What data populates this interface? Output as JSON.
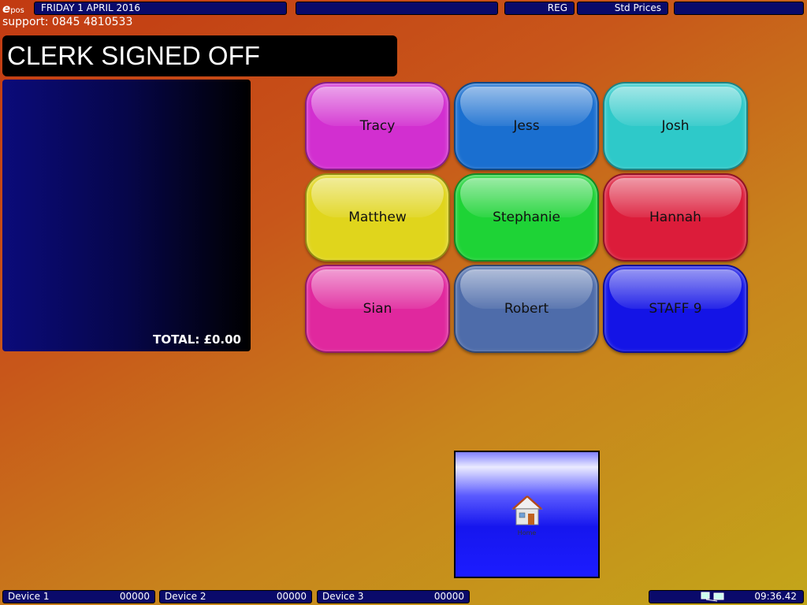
{
  "topbar": {
    "logo_main": "e",
    "logo_sub": "pos",
    "date": "FRIDAY 1 APRIL 2016",
    "mode": "REG",
    "price_level": "Std Prices"
  },
  "support": "support: 0845 4810533",
  "status": "CLERK SIGNED OFF",
  "receipt": {
    "total": "TOTAL: £0.00"
  },
  "clerks": [
    {
      "label": "Tracy",
      "color": "#d22fd0"
    },
    {
      "label": "Jess",
      "color": "#1a6fd0"
    },
    {
      "label": "Josh",
      "color": "#2ec9c9"
    },
    {
      "label": "Matthew",
      "color": "#e0d51c"
    },
    {
      "label": "Stephanie",
      "color": "#1ed336"
    },
    {
      "label": "Hannah",
      "color": "#dc1c3a"
    },
    {
      "label": "Sian",
      "color": "#e0289e"
    },
    {
      "label": "Robert",
      "color": "#4e6caa"
    },
    {
      "label": "STAFF 9",
      "color": "#1414e6"
    }
  ],
  "home": {
    "label": "Home",
    "icon": "house-icon"
  },
  "devices": [
    {
      "label": "Device 1",
      "count": "00000"
    },
    {
      "label": "Device 2",
      "count": "00000"
    },
    {
      "label": "Device 3",
      "count": "00000"
    }
  ],
  "tray": {
    "time": "09:36.42",
    "icon": "network-icon"
  }
}
